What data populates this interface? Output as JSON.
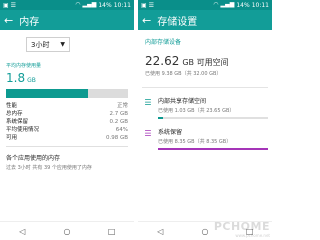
{
  "left": {
    "status": {
      "signal": "▂▄▆",
      "battery": "14%",
      "time": "10:11"
    },
    "title": "内存",
    "period": {
      "selected": "3小时"
    },
    "avg_label": "平均内存使用量",
    "avg_value": "1.8",
    "avg_unit": "GB",
    "usage_fraction": 0.67,
    "colors": {
      "bar": "#0d9a90",
      "track": "#dcdcdc",
      "accent": "#129d98"
    },
    "stats": [
      {
        "label": "性能",
        "value": "正常"
      },
      {
        "label": "总内存",
        "value": "2.7 GB"
      },
      {
        "label": "系统保留",
        "value": "0.2 GB"
      },
      {
        "label": "平均使用情况",
        "value": "64%"
      },
      {
        "label": "可用",
        "value": "0.98 GB"
      }
    ],
    "apps_title": "各个应用使用的内存",
    "apps_sub": "过去 3小时 共有 39 个应用使用了内存"
  },
  "right": {
    "status": {
      "signal": "▂▄▆",
      "battery": "14%",
      "time": "10:11"
    },
    "title": "存储设置",
    "section": "内部存储设备",
    "total_value": "22.62",
    "total_unit": "GB 可用空间",
    "total_sub": "已使用 9.38 GB（共 32.00 GB）",
    "items": [
      {
        "title": "内部共享存储空间",
        "sub": "已使用 1.03 GB（共 23.65 GB）",
        "fraction": 0.044,
        "color": "#0d9a90",
        "icon": "list-icon"
      },
      {
        "title": "系统保留",
        "sub": "已使用 8.35 GB（共 8.35 GB）",
        "fraction": 1.0,
        "color": "#a535b8",
        "icon": "list-icon"
      }
    ]
  },
  "nav": {
    "back": "◁",
    "home": "○",
    "recent": "□"
  },
  "watermark": {
    "main": "PCHOME",
    "sub": "www.pchome.net"
  }
}
